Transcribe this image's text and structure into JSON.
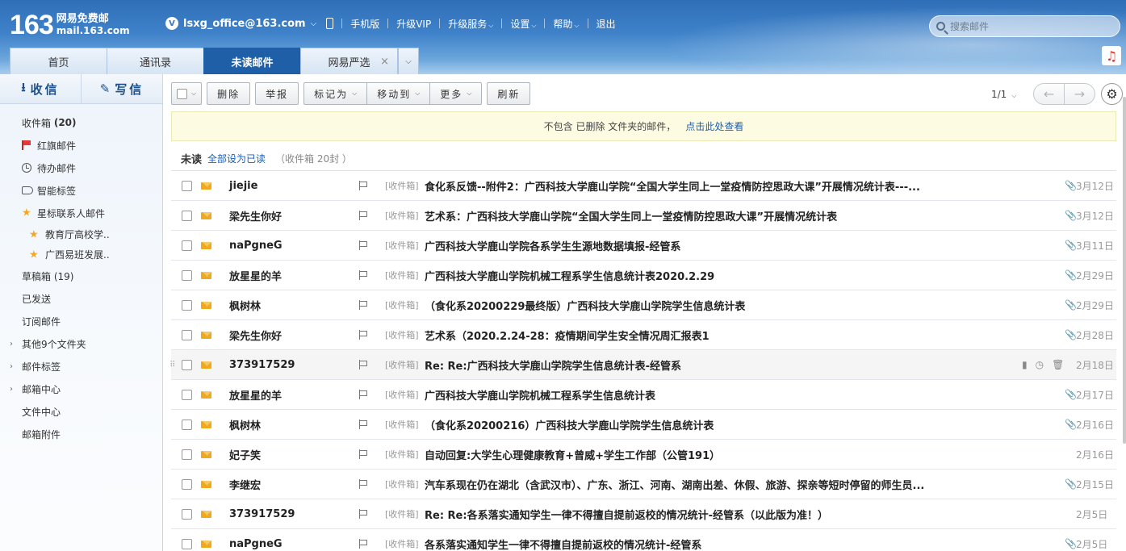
{
  "header": {
    "logo_num": "163",
    "logo_cn": "网易免费邮",
    "logo_domain": "mail.163.com",
    "account_badge": "V",
    "account": "lsxg_office@163.com",
    "links": [
      "手机版",
      "升级VIP",
      "升级服务",
      "设置",
      "帮助",
      "退出"
    ],
    "search_placeholder": "搜索邮件"
  },
  "tabs": [
    {
      "label": "首页",
      "active": false
    },
    {
      "label": "通讯录",
      "active": false
    },
    {
      "label": "未读邮件",
      "active": true
    },
    {
      "label": "网易严选",
      "active": false,
      "closable": true
    }
  ],
  "sidebar": {
    "receive": "收信",
    "compose": "写信",
    "items": {
      "inbox": "收件箱",
      "inbox_count": "(20)",
      "red_flag": "红旗邮件",
      "todo": "待办邮件",
      "smart_tags": "智能标签",
      "star_contacts": "星标联系人邮件",
      "star_sub1": "教育厅高校学..",
      "star_sub2": "广西易班发展..",
      "drafts": "草稿箱 (19)",
      "sent": "已发送",
      "subscriptions": "订阅邮件",
      "other_folders": "其他9个文件夹",
      "mail_tags": "邮件标签",
      "mail_center": "邮箱中心",
      "file_center": "文件中心",
      "attachments": "邮箱附件"
    }
  },
  "toolbar": {
    "delete": "删除",
    "report": "举报",
    "mark_as": "标记为",
    "move_to": "移动到",
    "more": "更多",
    "refresh": "刷新",
    "page": "1/1"
  },
  "notice": {
    "text": "不包含 已删除 文件夹的邮件，",
    "link": "点击此处查看"
  },
  "section": {
    "label": "未读",
    "mark_all": "全部设为已读",
    "count": "（收件箱 20封 ）"
  },
  "mails": [
    {
      "sender": "jiejie",
      "folder": "[收件箱]",
      "subject": "食化系反馈--附件2：广西科技大学鹿山学院“全国大学生同上一堂疫情防控思政大课”开展情况统计表---...",
      "date": "3月12日",
      "attach": true
    },
    {
      "sender": "梁先生你好",
      "folder": "[收件箱]",
      "subject": "艺术系：广西科技大学鹿山学院“全国大学生同上一堂疫情防控思政大课”开展情况统计表",
      "date": "3月12日",
      "attach": true
    },
    {
      "sender": "naPgneG",
      "folder": "[收件箱]",
      "subject": "广西科技大学鹿山学院各系学生生源地数据填报-经管系",
      "date": "3月11日",
      "attach": true
    },
    {
      "sender": "放星星的羊",
      "folder": "[收件箱]",
      "subject": "广西科技大学鹿山学院机械工程系学生信息统计表2020.2.29",
      "date": "2月29日",
      "attach": true
    },
    {
      "sender": "枫树林",
      "folder": "[收件箱]",
      "subject": "（食化系20200229最终版）广西科技大学鹿山学院学生信息统计表",
      "date": "2月29日",
      "attach": true
    },
    {
      "sender": "梁先生你好",
      "folder": "[收件箱]",
      "subject": "艺术系（2020.2.24-28：疫情期间学生安全情况周汇报表1",
      "date": "2月28日",
      "attach": true
    },
    {
      "sender": "373917529",
      "folder": "[收件箱]",
      "subject": "Re: Re:广西科技大学鹿山学院学生信息统计表-经管系",
      "date": "2月18日",
      "attach": false,
      "hover": true
    },
    {
      "sender": "放星星的羊",
      "folder": "[收件箱]",
      "subject": "广西科技大学鹿山学院机械工程系学生信息统计表",
      "date": "2月17日",
      "attach": true
    },
    {
      "sender": "枫树林",
      "folder": "[收件箱]",
      "subject": "（食化系20200216）广西科技大学鹿山学院学生信息统计表",
      "date": "2月16日",
      "attach": true
    },
    {
      "sender": "妃子笑",
      "folder": "[收件箱]",
      "subject": "自动回复:大学生心理健康教育+曾威+学生工作部（公管191）",
      "date": "2月16日",
      "attach": false
    },
    {
      "sender": "李继宏",
      "folder": "[收件箱]",
      "subject": "汽车系现在仍在湖北（含武汉市）、广东、浙江、河南、湖南出差、休假、旅游、探亲等短时停留的师生员...",
      "date": "2月15日",
      "attach": true
    },
    {
      "sender": "373917529",
      "folder": "[收件箱]",
      "subject": "Re: Re:各系落实通知学生一律不得擅自提前返校的情况统计-经管系（以此版为准！）",
      "date": "2月5日",
      "attach": false
    },
    {
      "sender": "naPgneG",
      "folder": "[收件箱]",
      "subject": "各系落实通知学生一律不得擅自提前返校的情况统计-经管系",
      "date": "2月5日",
      "attach": true
    }
  ]
}
